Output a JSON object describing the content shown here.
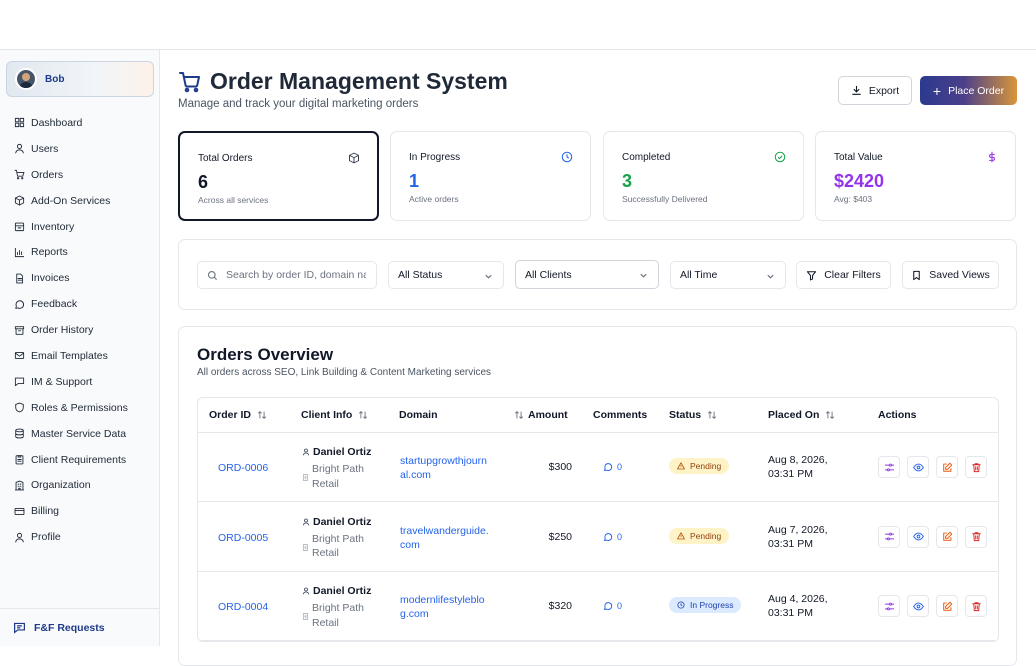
{
  "sidebar": {
    "user": {
      "name": "Bob"
    },
    "items": [
      {
        "label": "Dashboard",
        "icon": "dashboard-icon"
      },
      {
        "label": "Users",
        "icon": "user-icon"
      },
      {
        "label": "Orders",
        "icon": "cart-icon"
      },
      {
        "label": "Add-On Services",
        "icon": "package-icon"
      },
      {
        "label": "Inventory",
        "icon": "inventory-icon"
      },
      {
        "label": "Reports",
        "icon": "bar-chart-icon"
      },
      {
        "label": "Invoices",
        "icon": "file-icon"
      },
      {
        "label": "Feedback",
        "icon": "message-icon"
      },
      {
        "label": "Order History",
        "icon": "archive-icon"
      },
      {
        "label": "Email Templates",
        "icon": "mail-icon"
      },
      {
        "label": "IM & Support",
        "icon": "chat-icon"
      },
      {
        "label": "Roles & Permissions",
        "icon": "shield-icon"
      },
      {
        "label": "Master Service Data",
        "icon": "database-icon"
      },
      {
        "label": "Client Requirements",
        "icon": "clipboard-icon"
      },
      {
        "label": "Organization",
        "icon": "building-icon"
      },
      {
        "label": "Billing",
        "icon": "credit-card-icon"
      },
      {
        "label": "Profile",
        "icon": "user-icon"
      }
    ],
    "bottom": {
      "label": "F&F Requests"
    }
  },
  "header": {
    "title": "Order Management System",
    "subtitle": "Manage and track your digital marketing orders",
    "export_label": "Export",
    "place_order_label": "Place Order"
  },
  "stats": [
    {
      "label": "Total Orders",
      "value": "6",
      "hint": "Across all services",
      "color": "#111827"
    },
    {
      "label": "In Progress",
      "value": "1",
      "hint": "Active orders",
      "color": "#2563eb"
    },
    {
      "label": "Completed",
      "value": "3",
      "hint": "Successfully Delivered",
      "color": "#16a34a"
    },
    {
      "label": "Total Value",
      "value": "$2420",
      "hint": "Avg: $403",
      "color": "#9333ea"
    }
  ],
  "filters": {
    "search_placeholder": "Search by order ID, domain na",
    "status": "All Status",
    "clients": "All Clients",
    "time": "All Time",
    "clear_label": "Clear Filters",
    "saved_label": "Saved Views"
  },
  "orders": {
    "title": "Orders Overview",
    "subtitle": "All orders across SEO, Link Building & Content Marketing services",
    "columns": [
      "Order ID",
      "Client Info",
      "Domain",
      "Amount",
      "Comments",
      "Status",
      "Placed On",
      "Actions"
    ],
    "rows": [
      {
        "id": "ORD-0006",
        "client": "Daniel Ortiz",
        "org": "Bright Path Retail",
        "domain": "startupgrowthjournal.com",
        "amount": "$300",
        "comments": "0",
        "status": "Pending",
        "placed": "Aug 8, 2026, 03:31 PM"
      },
      {
        "id": "ORD-0005",
        "client": "Daniel Ortiz",
        "org": "Bright Path Retail",
        "domain": "travelwanderguide.com",
        "amount": "$250",
        "comments": "0",
        "status": "Pending",
        "placed": "Aug 7, 2026, 03:31 PM"
      },
      {
        "id": "ORD-0004",
        "client": "Daniel Ortiz",
        "org": "Bright Path Retail",
        "domain": "modernlifestyleblog.com",
        "amount": "$320",
        "comments": "0",
        "status": "In Progress",
        "placed": "Aug 4, 2026, 03:31 PM"
      }
    ]
  }
}
